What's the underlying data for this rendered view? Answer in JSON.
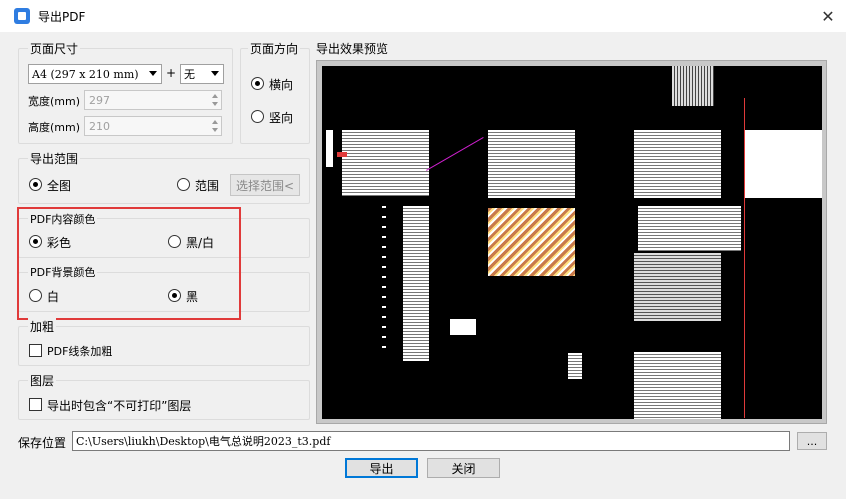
{
  "window": {
    "title": "导出PDF",
    "close_glyph": "✕"
  },
  "page_size": {
    "group_label": "页面尺寸",
    "paper_select": "A4 (297 x 210 mm)",
    "plus": "+",
    "margin_select": "无",
    "width_label": "宽度(mm)",
    "width_value": "297",
    "height_label": "高度(mm)",
    "height_value": "210"
  },
  "orientation": {
    "group_label": "页面方向",
    "landscape": "横向",
    "portrait": "竖向",
    "selected": "landscape"
  },
  "export_range": {
    "group_label": "导出范围",
    "full": "全图",
    "range": "范围",
    "select_range_button": "选择范围<",
    "selected": "full"
  },
  "content_color": {
    "group_label": "PDF内容颜色",
    "color": "彩色",
    "bw": "黑/白",
    "selected": "color"
  },
  "background_color": {
    "group_label": "PDF背景颜色",
    "white": "白",
    "black": "黑",
    "selected": "black"
  },
  "bold": {
    "group_label": "加粗",
    "checkbox_label": "PDF线条加粗",
    "checked": false
  },
  "layers": {
    "group_label": "图层",
    "checkbox_label": "导出时包含“不可打印”图层",
    "checked": false
  },
  "preview": {
    "label": "导出效果预览"
  },
  "save": {
    "label": "保存位置",
    "path": "C:\\Users\\liukh\\Desktop\\电气总说明2023_t3.pdf",
    "browse": "..."
  },
  "buttons": {
    "export": "导出",
    "close": "关闭"
  },
  "colors": {
    "highlight_box": "#e03a3a",
    "accent": "#0078d7",
    "preview_bg": "#000000"
  }
}
